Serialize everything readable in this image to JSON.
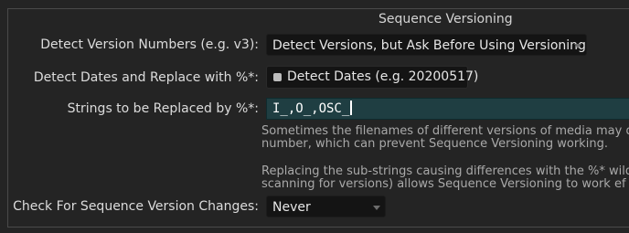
{
  "group": {
    "title": "Sequence Versioning"
  },
  "rows": {
    "detect_version": {
      "label": "Detect Version Numbers (e.g. v3):",
      "value": "Detect Versions, but Ask Before Using Versioning"
    },
    "detect_dates": {
      "label": "Detect Dates and Replace with %*:",
      "value": "Detect Dates (e.g. 20200517)"
    },
    "strings_replace": {
      "label": "Strings to be Replaced by %*:",
      "value": "I_,O_,OSC_"
    },
    "check_changes": {
      "label": "Check For Sequence Version Changes:",
      "value": "Never"
    }
  },
  "help": {
    "line1": "Sometimes the filenames of different versions of media may d",
    "line2": "number, which can prevent Sequence Versioning working.",
    "line3": "Replacing the sub-strings causing differences with the %* wild",
    "line4": "scanning for versions) allows Sequence Versioning to work ef"
  },
  "icons": {
    "dropdown_arrow": "chevron-down-icon",
    "toggle_indicator": "checkbox-indicator-icon"
  },
  "colors": {
    "panel_bg": "#242424",
    "field_bg": "#141414",
    "active_field_bg": "#1f3e42",
    "label_text": "#dcdcdc",
    "help_text": "#a9a9a9"
  }
}
